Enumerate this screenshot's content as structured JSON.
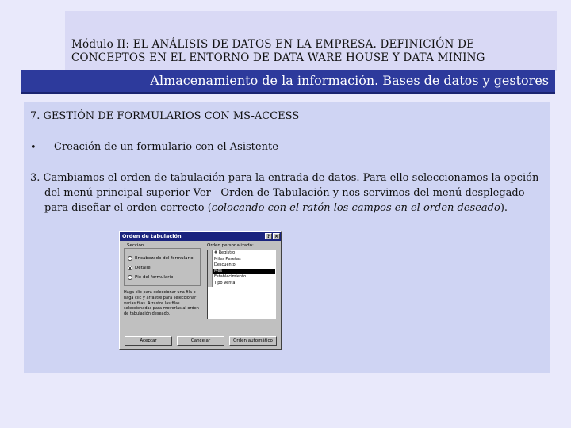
{
  "header": {
    "module_line1": "Módulo II: EL ANÁLISIS DE DATOS EN LA EMPRESA. DEFINICIÓN DE",
    "module_line2": "CONCEPTOS EN EL ENTORNO DE DATA WARE HOUSE Y DATA MINING"
  },
  "banner": {
    "title": "Almacenamiento de la información. Bases de datos y gestores"
  },
  "content": {
    "section_title": "7. GESTIÓN DE FORMULARIOS CON MS-ACCESS",
    "bullet_symbol": "•",
    "bullet_text": "Creación de un formulario con el Asistente",
    "para_main": "3. Cambiamos el orden de tabulación para la entrada de datos. Para ello seleccionamos la opción del menú principal superior Ver - Orden de Tabulación y nos servimos del menú desplegado para diseñar el orden correcto (",
    "para_italic": "colocando con el ratón los campos en el orden deseado",
    "para_end": ")."
  },
  "dialog": {
    "title": "Orden de tabulación",
    "help_btn": "?",
    "close_btn": "×",
    "section_label": "Sección",
    "radio_1": "Encabezado del formulario",
    "radio_2": "Detalle",
    "radio_3": "Pie del formulario",
    "selected_radio": "Detalle",
    "hint": "Haga clic para seleccionar una fila o haga clic y arrastre para seleccionar varias filas. Arrastre las filas seleccionadas para moverlas al orden de tabulación deseado.",
    "list_label": "Orden personalizado:",
    "list_items": [
      "# Registro",
      "Miles Pesetas",
      "Descuento",
      "Mes",
      "Establecimiento",
      "Tipo Venta"
    ],
    "active_item": "Mes",
    "btn_accept": "Aceptar",
    "btn_cancel": "Cancelar",
    "btn_auto": "Orden automático"
  }
}
